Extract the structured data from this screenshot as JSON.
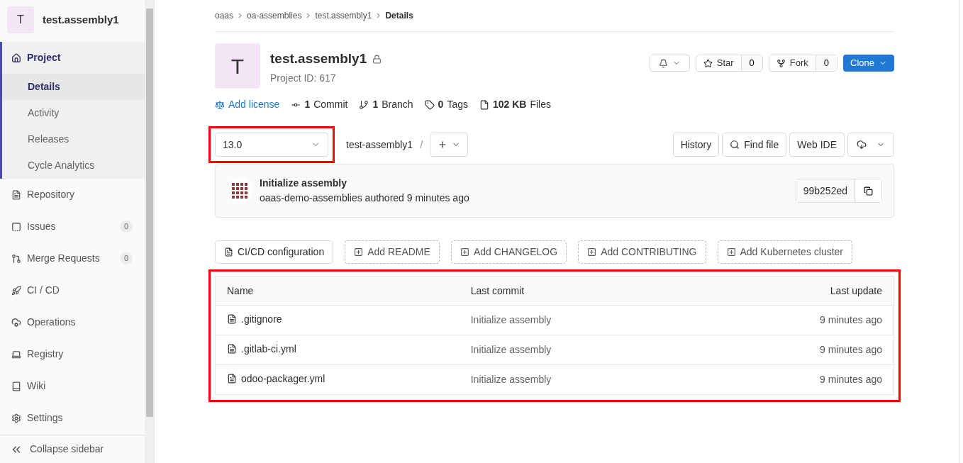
{
  "sidebar": {
    "project_avatar": "T",
    "project_name": "test.assembly1",
    "items": [
      {
        "label": "Project",
        "selected": true,
        "children": [
          {
            "label": "Details",
            "selected": true
          },
          {
            "label": "Activity",
            "selected": false
          },
          {
            "label": "Releases",
            "selected": false
          },
          {
            "label": "Cycle Analytics",
            "selected": false
          }
        ]
      },
      {
        "label": "Repository",
        "selected": false
      },
      {
        "label": "Issues",
        "selected": false,
        "count": "0"
      },
      {
        "label": "Merge Requests",
        "selected": false,
        "count": "0"
      },
      {
        "label": "CI / CD",
        "selected": false
      },
      {
        "label": "Operations",
        "selected": false
      },
      {
        "label": "Registry",
        "selected": false
      },
      {
        "label": "Wiki",
        "selected": false
      },
      {
        "label": "Settings",
        "selected": false
      }
    ],
    "collapse": "Collapse sidebar"
  },
  "breadcrumbs": [
    "oaas",
    "oa-assemblies",
    "test.assembly1",
    "Details"
  ],
  "project": {
    "avatar": "T",
    "name": "test.assembly1",
    "id": "Project ID: 617",
    "star": "Star",
    "star_count": "0",
    "fork": "Fork",
    "fork_count": "0",
    "clone": "Clone"
  },
  "stats": [
    {
      "kind": "link",
      "text": "Add license"
    },
    {
      "kind": "commit",
      "bold": "1",
      "text": "Commit"
    },
    {
      "kind": "branch",
      "bold": "1",
      "text": "Branch"
    },
    {
      "kind": "tag",
      "bold": "0",
      "text": "Tags"
    },
    {
      "kind": "files",
      "bold": "102 KB",
      "text": "Files"
    }
  ],
  "toolbar": {
    "branch": "13.0",
    "path": "test-assembly1",
    "separator": "/",
    "history": "History",
    "find_file": "Find file",
    "web_ide": "Web IDE"
  },
  "last_commit": {
    "title": "Initialize assembly",
    "author_line": "oaas-demo-assemblies authored 9 minutes ago",
    "sha": "99b252ed"
  },
  "actions": [
    {
      "kind": "existing",
      "label": "CI/CD configuration"
    },
    {
      "kind": "add",
      "label": "Add README"
    },
    {
      "kind": "add",
      "label": "Add CHANGELOG"
    },
    {
      "kind": "add",
      "label": "Add CONTRIBUTING"
    },
    {
      "kind": "add",
      "label": "Add Kubernetes cluster"
    }
  ],
  "table": {
    "columns": [
      "Name",
      "Last commit",
      "Last update"
    ],
    "rows": [
      {
        "name": ".gitignore",
        "commit": "Initialize assembly",
        "updated": "9 minutes ago"
      },
      {
        "name": ".gitlab-ci.yml",
        "commit": "Initialize assembly",
        "updated": "9 minutes ago"
      },
      {
        "name": "odoo-packager.yml",
        "commit": "Initialize assembly",
        "updated": "9 minutes ago"
      }
    ]
  }
}
